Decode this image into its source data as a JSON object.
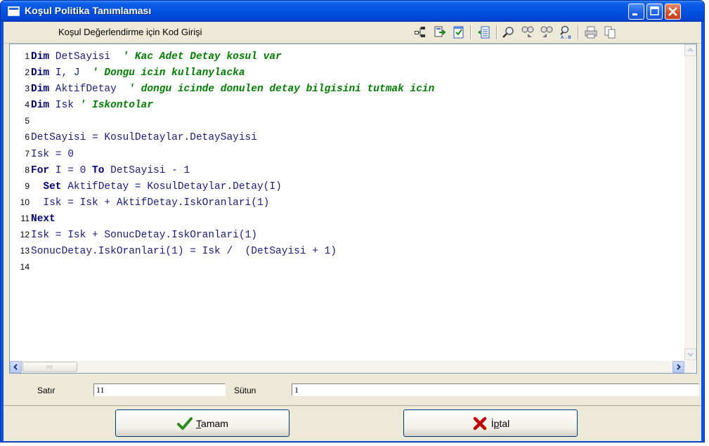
{
  "window": {
    "title": "Koşul Politika Tanımlaması"
  },
  "toolbar": {
    "label": "Koşul Değerlendirme için Kod Girişi",
    "tools": [
      "tree-icon",
      "import-icon",
      "validate-icon",
      "indent-icon",
      "find-icon",
      "find-next-icon",
      "find-prev-icon",
      "replace-icon",
      "print-icon",
      "copy-icon"
    ]
  },
  "code": {
    "lines": [
      {
        "n": "1"
      },
      {
        "n": "2"
      },
      {
        "n": "3"
      },
      {
        "n": "4"
      },
      {
        "n": "5"
      },
      {
        "n": "6"
      },
      {
        "n": "7"
      },
      {
        "n": "8"
      },
      {
        "n": "9"
      },
      {
        "n": "10"
      },
      {
        "n": "11"
      },
      {
        "n": "12"
      },
      {
        "n": "13"
      },
      {
        "n": "14"
      }
    ],
    "tokens": {
      "l1a": "Dim",
      "l1b": " DetSayisi  ",
      "l1c": "' Kac Adet Detay kosul var",
      "l2a": "Dim",
      "l2b": " I, J  ",
      "l2c": "' Dongu icin kullanylacka",
      "l3a": "Dim",
      "l3b": " AktifDetay  ",
      "l3c": "' dongu icinde donulen detay bilgisini tutmak icin",
      "l4a": "Dim",
      "l4b": " Isk ",
      "l4c": "' Iskontolar",
      "l6": "DetSayisi = KosulDetaylar.DetaySayisi",
      "l7": "Isk = 0",
      "l8a": "For",
      "l8b": " I = 0 ",
      "l8c": "To",
      "l8d": " DetSayisi - 1",
      "l9a": "  Set",
      "l9b": " AktifDetay = KosulDetaylar.Detay(I)",
      "l10": "  Isk = Isk + AktifDetay.IskOranlari(1)",
      "l11": "Next",
      "l12": "Isk = Isk + SonucDetay.IskOranlari(1)",
      "l13": "SonucDetay.IskOranlari(1) = Isk /  (DetSayisi + 1)"
    }
  },
  "status": {
    "row_label": "Satır",
    "row_value": "11",
    "col_label": "Sütun",
    "col_value": "1"
  },
  "buttons": {
    "ok_underlined": "T",
    "ok_rest": "amam",
    "cancel_first": "İ",
    "cancel_underlined": "p",
    "cancel_rest": "tal"
  },
  "colors": {
    "titlebar": "#0352e2",
    "close": "#d4512c",
    "keyword": "#00007a",
    "comment": "#008000",
    "ok_check": "#2a8a1a",
    "cancel_x": "#c00000"
  }
}
